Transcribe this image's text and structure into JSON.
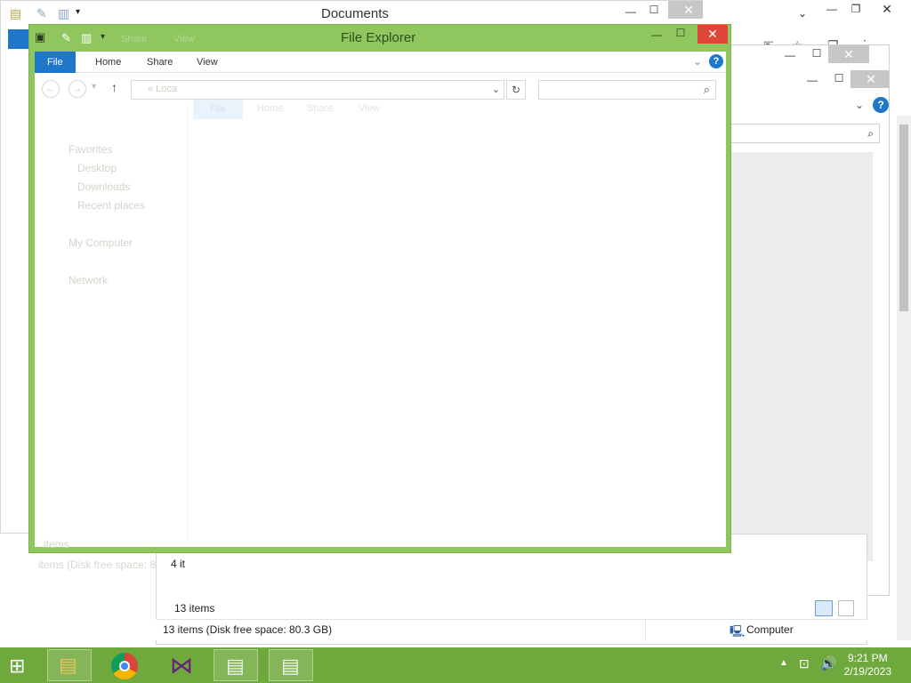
{
  "docs_window": {
    "title": "Documents"
  },
  "fe_window": {
    "title": "File Explorer",
    "tabs": [
      "File",
      "Home",
      "Share",
      "View"
    ],
    "address": "« Loca",
    "sidebar": [
      "Favorites",
      "Desktop",
      "Downloads",
      "Recent places",
      "My Computer",
      "Network"
    ],
    "status_items": "items",
    "status_disk": "items (Disk free space: 8",
    "ghost_tabs": [
      "Share",
      "View"
    ],
    "ghost_ribbon": [
      "File",
      "Home",
      "Share",
      "View"
    ]
  },
  "computer_window": {
    "status_left_partial": "4 it",
    "status_items": "13 items",
    "status_disk": "13 items (Disk free space: 80.3 GB)",
    "location": "Computer"
  },
  "taskbar": {
    "apps": [
      "file-explorer",
      "chrome",
      "visual-studio",
      "file-explorer-2",
      "file-explorer-3"
    ],
    "time": "9:21 PM",
    "date": "2/19/2023"
  },
  "colors": {
    "accent": "#1e77c9",
    "taskbar": "#6fa83c",
    "fe_frame": "#8fc65e",
    "close": "#e0453a"
  }
}
